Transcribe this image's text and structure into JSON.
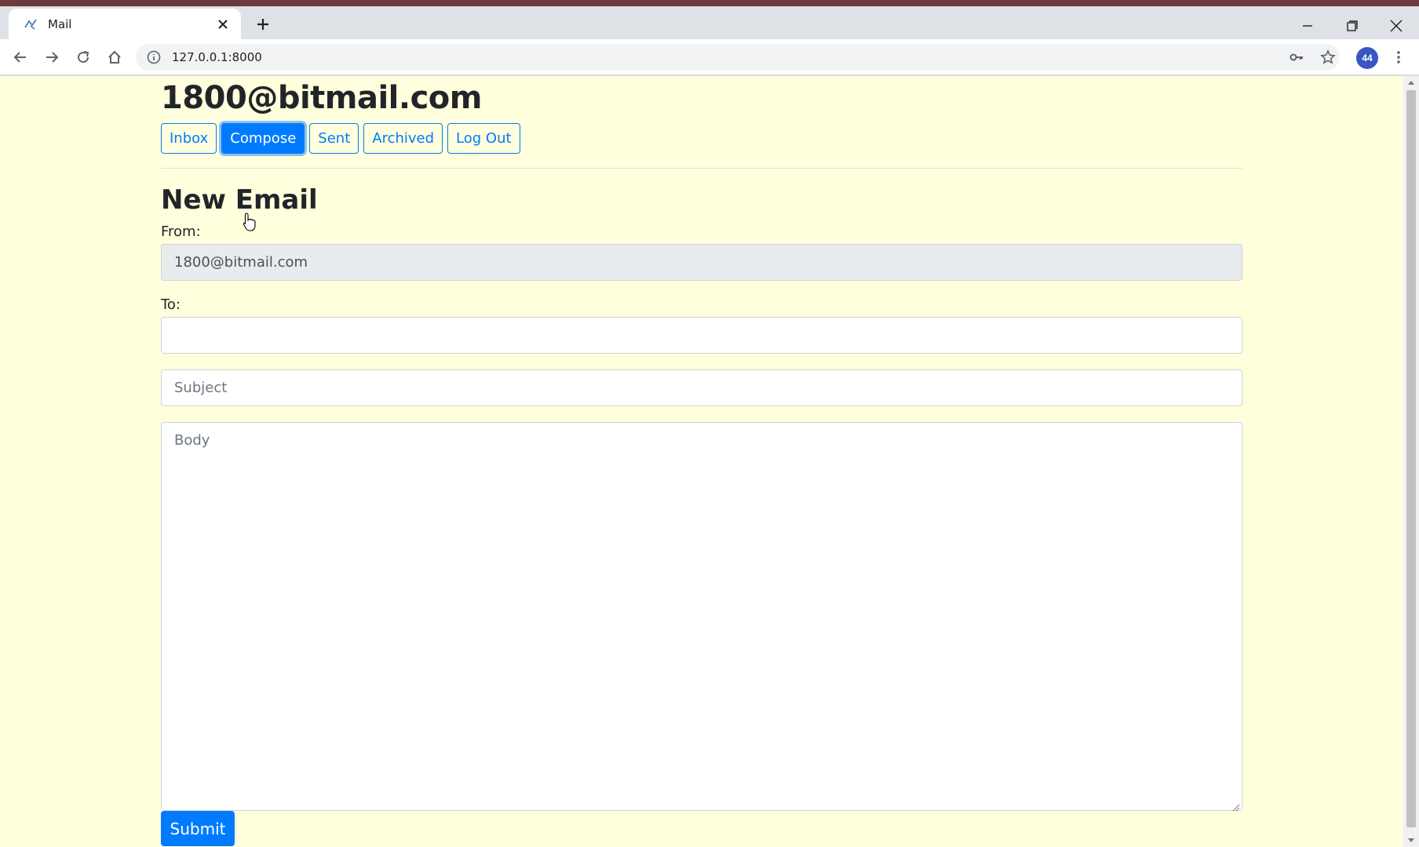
{
  "browser": {
    "tab_title": "Mail",
    "url": "127.0.0.1:8000",
    "profile_badge": "44"
  },
  "header": {
    "account": "1800@bitmail.com",
    "nav": [
      {
        "label": "Inbox",
        "active": false
      },
      {
        "label": "Compose",
        "active": true
      },
      {
        "label": "Sent",
        "active": false
      },
      {
        "label": "Archived",
        "active": false
      },
      {
        "label": "Log Out",
        "active": false
      }
    ]
  },
  "compose": {
    "heading": "New Email",
    "from_label": "From:",
    "from_value": "1800@bitmail.com",
    "to_label": "To:",
    "to_value": "",
    "subject_placeholder": "Subject",
    "body_placeholder": "Body",
    "submit_label": "Submit"
  },
  "colors": {
    "page_background": "#ffffdd",
    "primary": "#007bff",
    "tab_strip_accent": "#6b3a3c"
  },
  "icons": [
    "mail-favicon-icon",
    "close-icon",
    "plus-icon",
    "minimize-icon",
    "restore-icon",
    "window-close-icon",
    "back-arrow-icon",
    "forward-arrow-icon",
    "reload-icon",
    "home-icon",
    "info-icon",
    "key-icon",
    "star-icon",
    "kebab-menu-icon",
    "mouse-cursor-icon"
  ]
}
